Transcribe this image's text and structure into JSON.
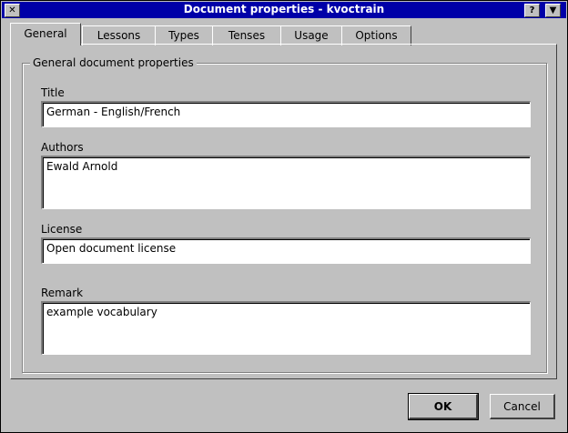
{
  "window": {
    "title": "Document properties - kvoctrain",
    "close_glyph": "✕",
    "help_glyph": "?",
    "menu_glyph": "▼"
  },
  "tabs": [
    {
      "label": "General",
      "active": true
    },
    {
      "label": "Lessons",
      "active": false
    },
    {
      "label": "Types",
      "active": false
    },
    {
      "label": "Tenses",
      "active": false
    },
    {
      "label": "Usage",
      "active": false
    },
    {
      "label": "Options",
      "active": false
    }
  ],
  "group": {
    "title": "General document properties",
    "title_label": "Title",
    "title_value": "German - English/French",
    "authors_label": "Authors",
    "authors_value": "Ewald Arnold",
    "license_label": "License",
    "license_value": "Open document license",
    "remark_label": "Remark",
    "remark_value": "example vocabulary"
  },
  "buttons": {
    "ok": "OK",
    "cancel": "Cancel"
  }
}
